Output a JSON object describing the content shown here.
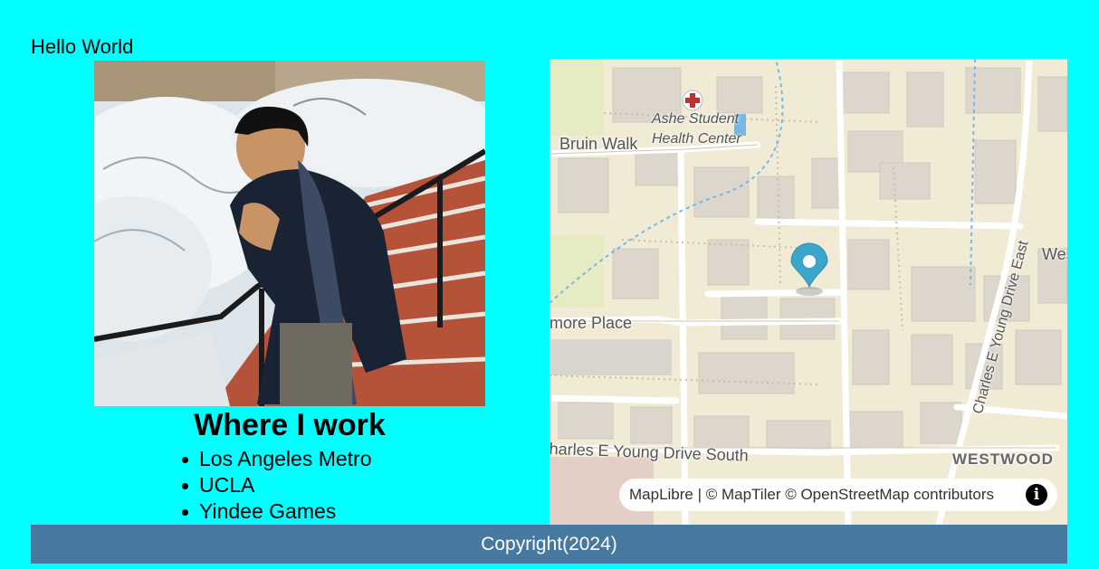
{
  "header": {
    "greeting": "Hello World"
  },
  "profile": {
    "photo_alt": "Person on snowy steps"
  },
  "work": {
    "title": "Where I work",
    "places": [
      "Los Angeles Metro",
      "UCLA",
      "Yindee Games"
    ]
  },
  "map": {
    "labels": {
      "health_center_line1": "Ashe Student",
      "health_center_line2": "Health Center",
      "bruin_walk": "Bruin Walk",
      "more_place": "more Place",
      "charles_young_south": "harles E Young Drive South",
      "charles_young_east": "Charles E Young Drive East",
      "westwood": "WESTWOOD",
      "west_edge": "Wes"
    },
    "attribution": "MapLibre | © MapTiler © OpenStreetMap contributors",
    "marker_color": "#3aa6c9"
  },
  "footer": {
    "copyright": "Copyright(2024)"
  }
}
